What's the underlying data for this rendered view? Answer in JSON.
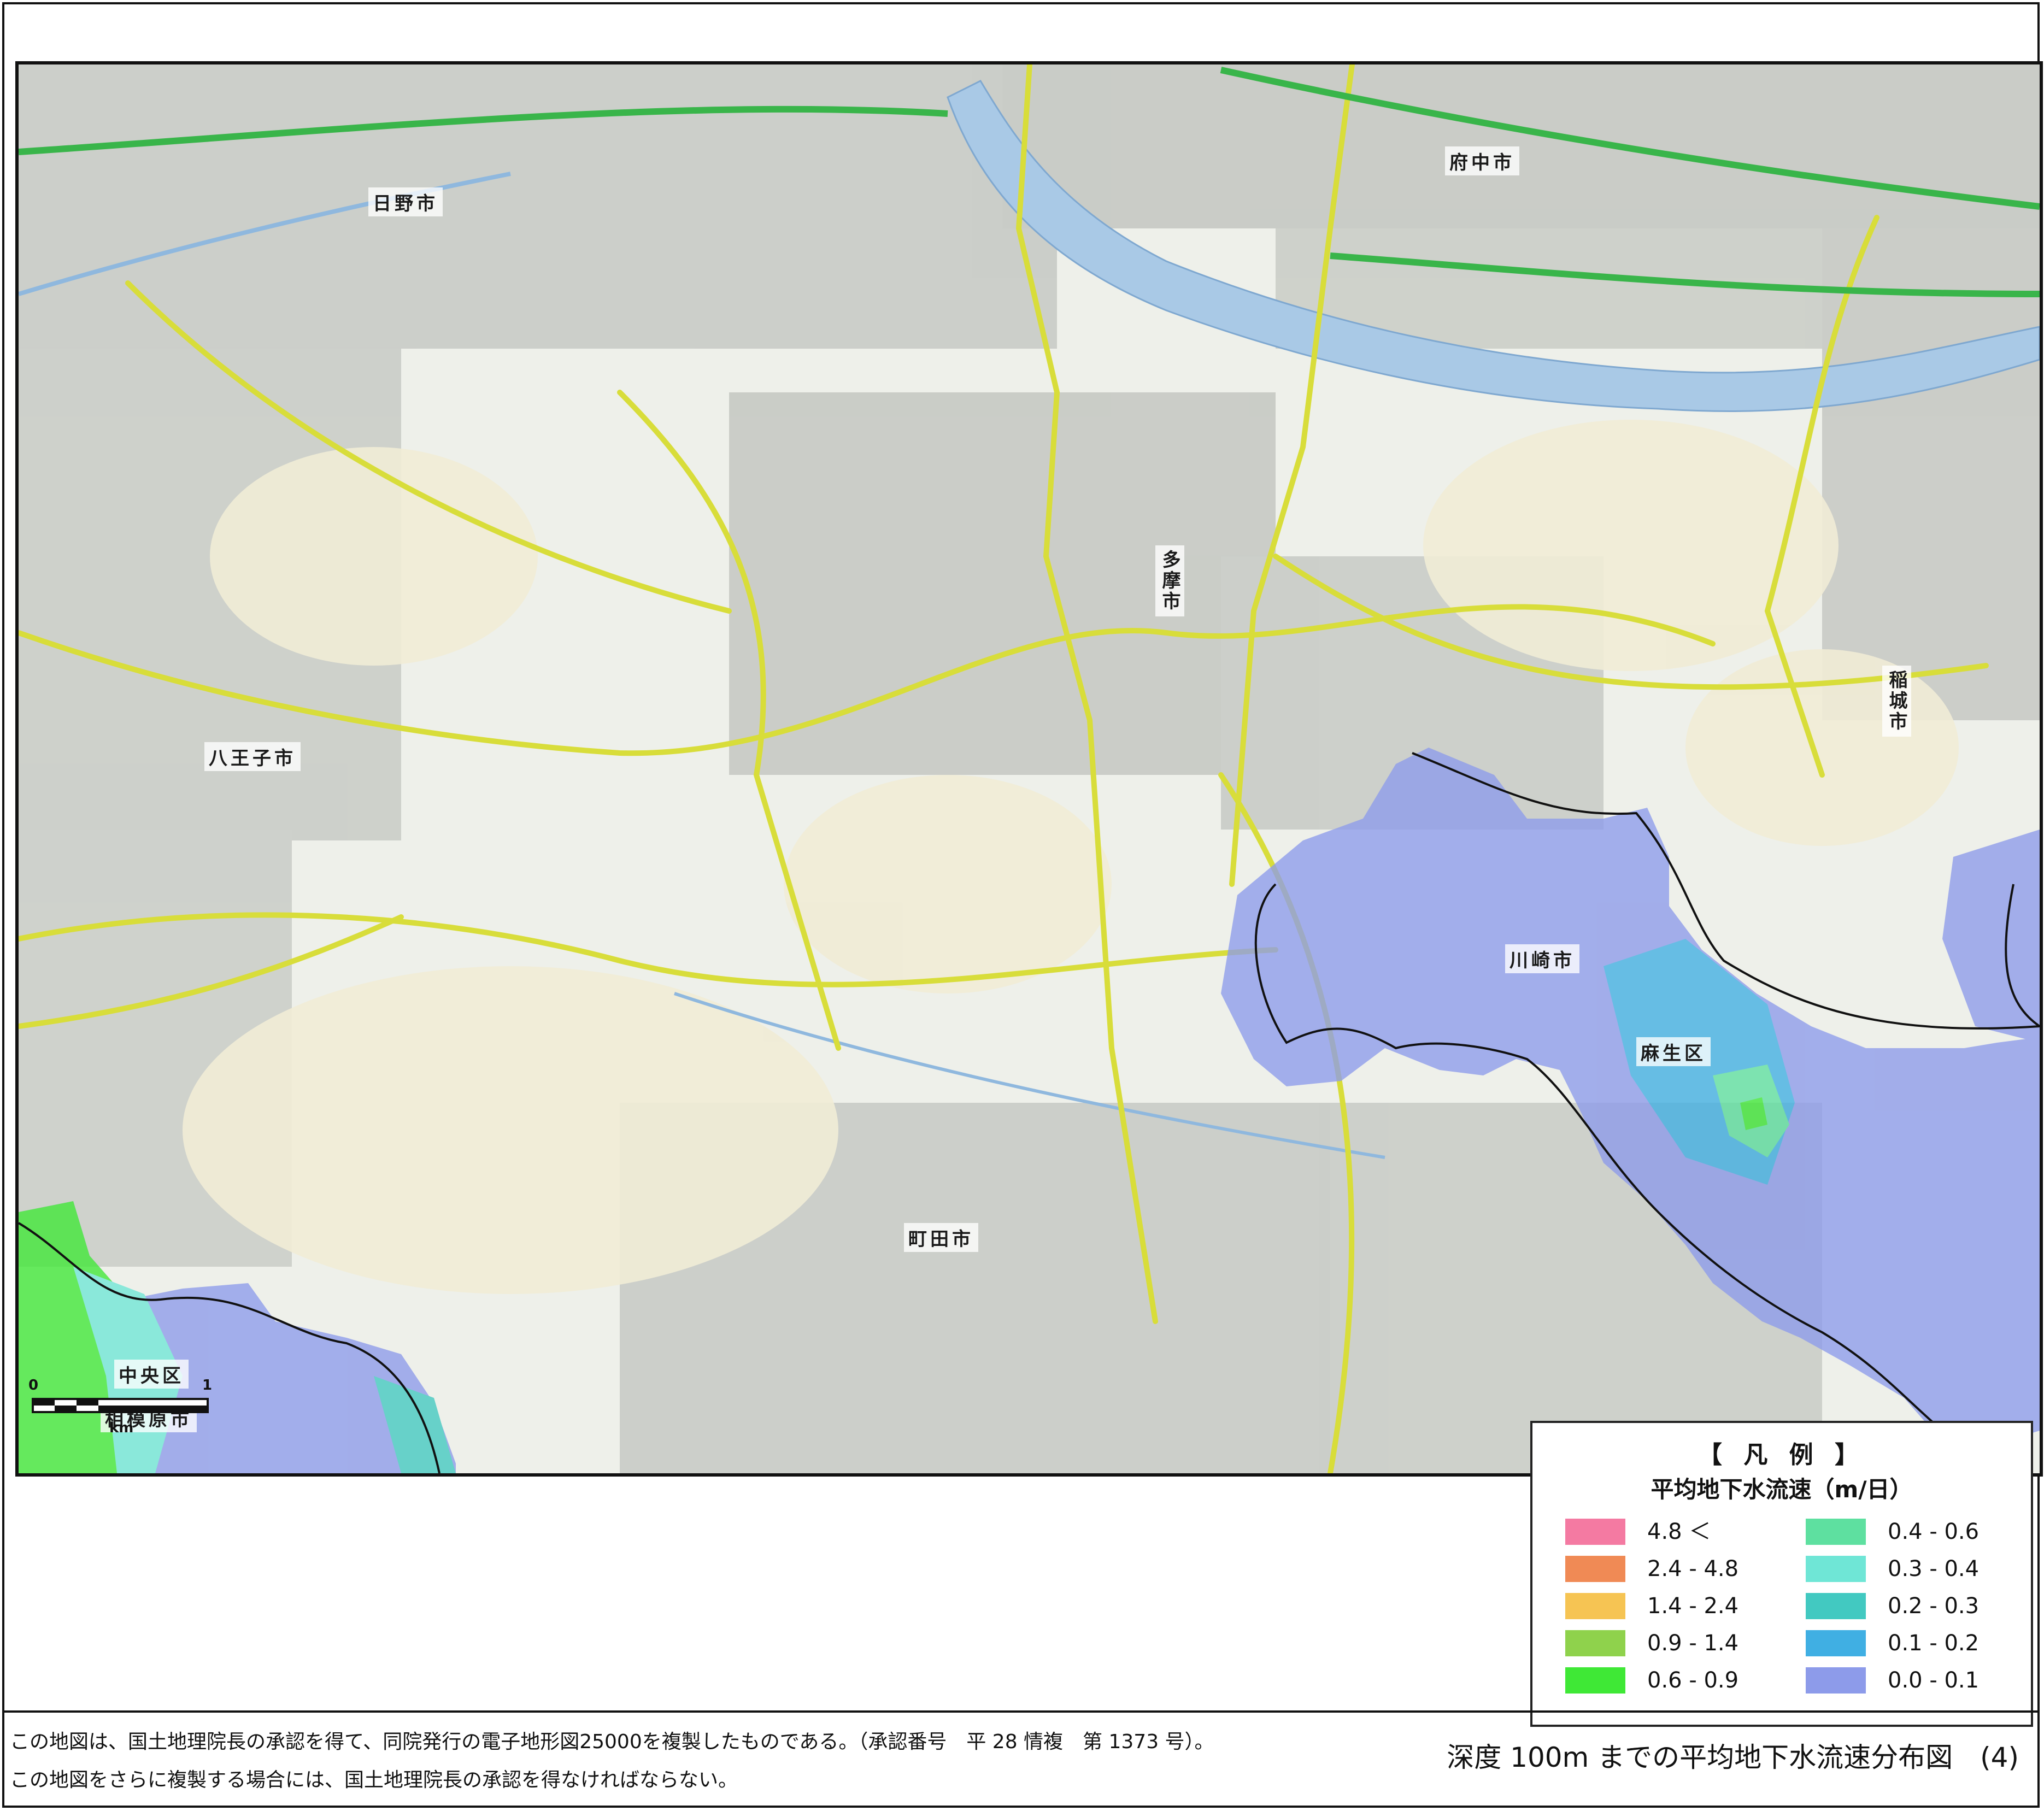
{
  "map": {
    "places": {
      "hino": "日野市",
      "fuchu": "府中市",
      "tama": "多摩市",
      "hachioji": "八王子市",
      "inagi": "稲城市",
      "kawasaki": "川崎市",
      "asao": "麻生区",
      "machida": "町田市",
      "chuo": "中央区",
      "sagamihara": "相模原市"
    },
    "colors": {
      "base_map": "#eef0ea",
      "urban_grey": "#b9bcb8",
      "road_yellow": "#d8dd3a",
      "river_blue": "#a9c9e6",
      "expressway_green": "#39b54a",
      "boundary": "#111111"
    }
  },
  "scale_bar": {
    "start": "0",
    "end": "1",
    "unit": "km"
  },
  "legend": {
    "title": "【 凡 例 】",
    "subtitle": "平均地下水流速（m/日）",
    "items": [
      {
        "label": "4.8 ＜",
        "color": "#f47aa2"
      },
      {
        "label": "2.4 - 4.8",
        "color": "#f08a55"
      },
      {
        "label": "1.4 - 2.4",
        "color": "#f6c453"
      },
      {
        "label": "0.9 - 1.4",
        "color": "#8fd24c"
      },
      {
        "label": "0.6 - 0.9",
        "color": "#3fe836"
      },
      {
        "label": "0.4 - 0.6",
        "color": "#5ee0a0"
      },
      {
        "label": "0.3 - 0.4",
        "color": "#6fe6d6"
      },
      {
        "label": "0.2 - 0.3",
        "color": "#42c9c1"
      },
      {
        "label": "0.1 - 0.2",
        "color": "#40afe3"
      },
      {
        "label": "0.0 - 0.1",
        "color": "#8d9bea"
      }
    ]
  },
  "footer": {
    "note_line1": "この地図は、国土地理院長の承認を得て、同院発行の電子地形図25000を複製したものである。（承認番号　平 28 情複　第 1373 号）。",
    "note_line2": "この地図をさらに複製する場合には、国土地理院長の承認を得なければならない。",
    "figure_title": "深度 100m までの平均地下水流速分布図　(4)"
  }
}
